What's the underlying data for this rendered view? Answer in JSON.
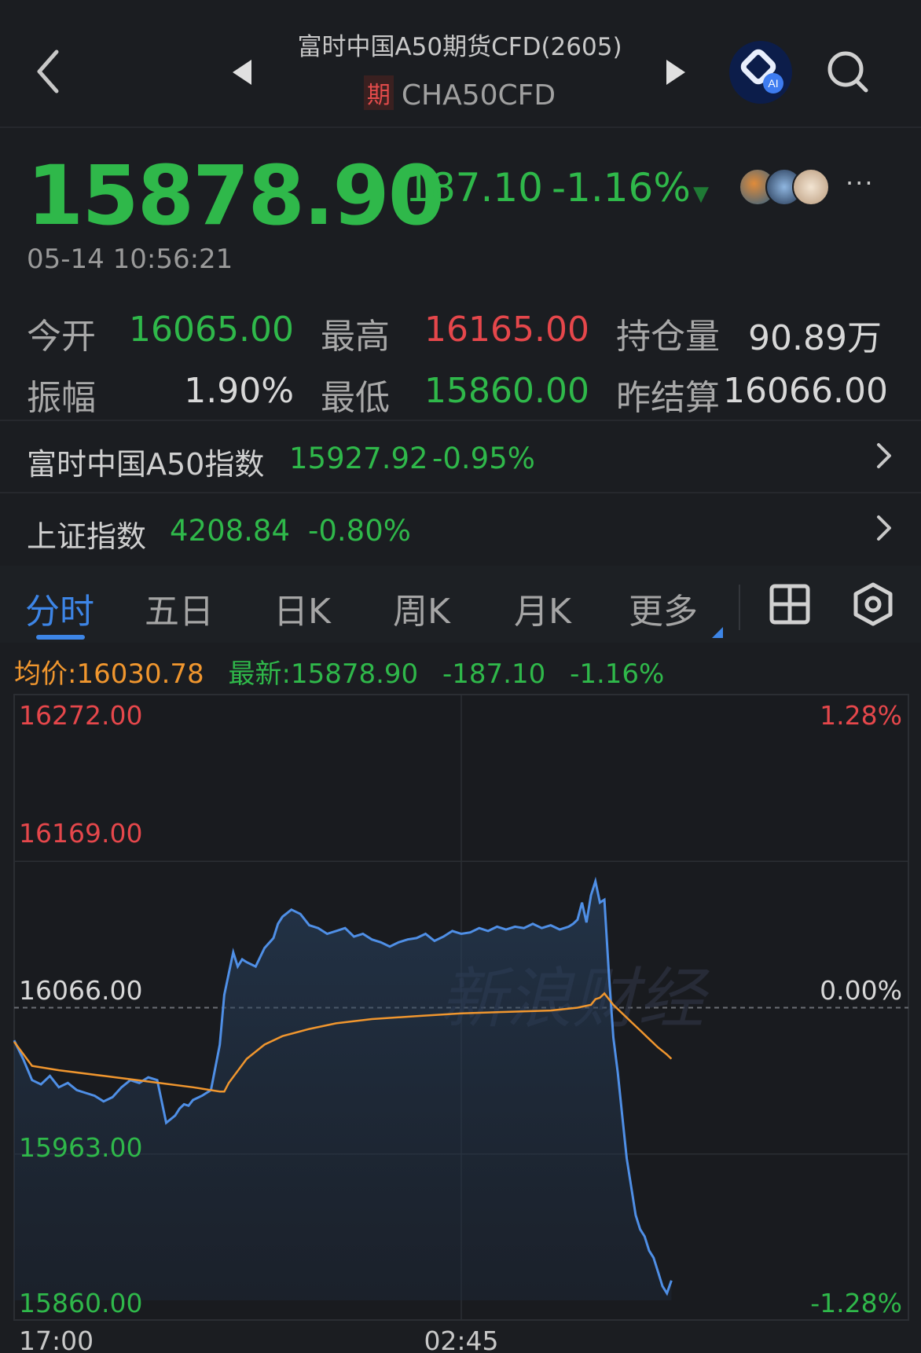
{
  "header": {
    "title": "富时中国A50期货CFD(2605)",
    "badge": "期",
    "code": "CHA50CFD",
    "ai_label": "AI"
  },
  "quote": {
    "price": "15878.90",
    "change": "-187.10",
    "change_pct": "-1.16%",
    "timestamp": "05-14 10:56:21",
    "more": "···",
    "stats": [
      {
        "label": "今开",
        "value": "16065.00",
        "color": "#2fb84a"
      },
      {
        "label": "最高",
        "value": "16165.00",
        "color": "#e5474b"
      },
      {
        "label": "持仓量",
        "value": "90.89万",
        "color": "#d8d8d8"
      },
      {
        "label": "振幅",
        "value": "1.90%",
        "color": "#d8d8d8"
      },
      {
        "label": "最低",
        "value": "15860.00",
        "color": "#2fb84a"
      },
      {
        "label": "昨结算",
        "value": "16066.00",
        "color": "#d8d8d8"
      }
    ]
  },
  "related": [
    {
      "name": "富时中国A50指数",
      "value": "15927.92",
      "pct": "-0.95%"
    },
    {
      "name": "上证指数",
      "value": "4208.84",
      "pct": "-0.80%"
    }
  ],
  "tabs": [
    {
      "label": "分时",
      "active": true
    },
    {
      "label": "五日",
      "active": false
    },
    {
      "label": "日K",
      "active": false
    },
    {
      "label": "周K",
      "active": false
    },
    {
      "label": "月K",
      "active": false
    },
    {
      "label": "更多",
      "active": false
    }
  ],
  "legend": {
    "avg": "均价:16030.78",
    "latest": "最新:15878.90",
    "change": "-187.10",
    "pct": "-1.16%"
  },
  "watermark": "新浪财经",
  "chart_data": {
    "type": "line",
    "ylim": [
      15860,
      16272
    ],
    "y_ticks_left": [
      "16272.00",
      "16169.00",
      "16066.00",
      "15963.00",
      "15860.00"
    ],
    "y_ticks_right": [
      "1.28%",
      "0.00%",
      "-1.28%"
    ],
    "x_ticks": [
      "17:00",
      "02:45"
    ],
    "baseline": 16066,
    "colors": {
      "price": "#4f8fe6",
      "avg": "#f0962e",
      "up": "#e5474b",
      "down": "#2fb84a"
    },
    "series": [
      {
        "name": "最新",
        "x": [
          0,
          0.01,
          0.02,
          0.03,
          0.04,
          0.05,
          0.06,
          0.07,
          0.08,
          0.09,
          0.1,
          0.11,
          0.12,
          0.13,
          0.14,
          0.15,
          0.16,
          0.17,
          0.18,
          0.185,
          0.19,
          0.195,
          0.2,
          0.21,
          0.22,
          0.23,
          0.235,
          0.24,
          0.245,
          0.25,
          0.255,
          0.26,
          0.27,
          0.28,
          0.29,
          0.295,
          0.3,
          0.31,
          0.32,
          0.33,
          0.34,
          0.35,
          0.36,
          0.37,
          0.38,
          0.39,
          0.4,
          0.41,
          0.42,
          0.43,
          0.44,
          0.45,
          0.46,
          0.47,
          0.48,
          0.49,
          0.5,
          0.51,
          0.52,
          0.53,
          0.54,
          0.55,
          0.56,
          0.57,
          0.58,
          0.59,
          0.6,
          0.61,
          0.62,
          0.625,
          0.63,
          0.635,
          0.64,
          0.645,
          0.65,
          0.655,
          0.66,
          0.665,
          0.67,
          0.675,
          0.68,
          0.685,
          0.69,
          0.695,
          0.7,
          0.705,
          0.71,
          0.715,
          0.72,
          0.725,
          0.73,
          0.735
        ],
        "y": [
          16043,
          16030,
          16015,
          16012,
          16018,
          16010,
          16013,
          16008,
          16006,
          16004,
          16000,
          16003,
          16010,
          16015,
          16013,
          16017,
          16015,
          15985,
          15990,
          15995,
          15998,
          15997,
          16001,
          16004,
          16008,
          16040,
          16075,
          16090,
          16105,
          16095,
          16100,
          16098,
          16095,
          16108,
          16115,
          16125,
          16130,
          16135,
          16132,
          16124,
          16122,
          16118,
          16120,
          16122,
          16116,
          16118,
          16114,
          16112,
          16109,
          16112,
          16114,
          16115,
          16118,
          16113,
          16116,
          16120,
          16118,
          16119,
          16122,
          16120,
          16123,
          16121,
          16123,
          16122,
          16125,
          16122,
          16124,
          16121,
          16123,
          16125,
          16128,
          16140,
          16126,
          16145,
          16155,
          16140,
          16142,
          16090,
          16045,
          16020,
          15990,
          15960,
          15940,
          15920,
          15910,
          15905,
          15895,
          15890,
          15880,
          15870,
          15865,
          15874
        ]
      },
      {
        "name": "均价",
        "x": [
          0,
          0.02,
          0.05,
          0.1,
          0.15,
          0.2,
          0.23,
          0.235,
          0.24,
          0.26,
          0.28,
          0.3,
          0.33,
          0.36,
          0.4,
          0.45,
          0.5,
          0.55,
          0.6,
          0.63,
          0.645,
          0.65,
          0.655,
          0.66,
          0.67,
          0.68,
          0.69,
          0.7,
          0.71,
          0.72,
          0.73,
          0.735
        ],
        "y": [
          16042,
          16025,
          16022,
          16018,
          16014,
          16010,
          16007,
          16007,
          16013,
          16030,
          16040,
          16046,
          16051,
          16055,
          16058,
          16060,
          16062,
          16063,
          16064,
          16066,
          16068,
          16072,
          16073,
          16076,
          16068,
          16062,
          16056,
          16050,
          16044,
          16038,
          16033,
          16030
        ]
      }
    ]
  }
}
